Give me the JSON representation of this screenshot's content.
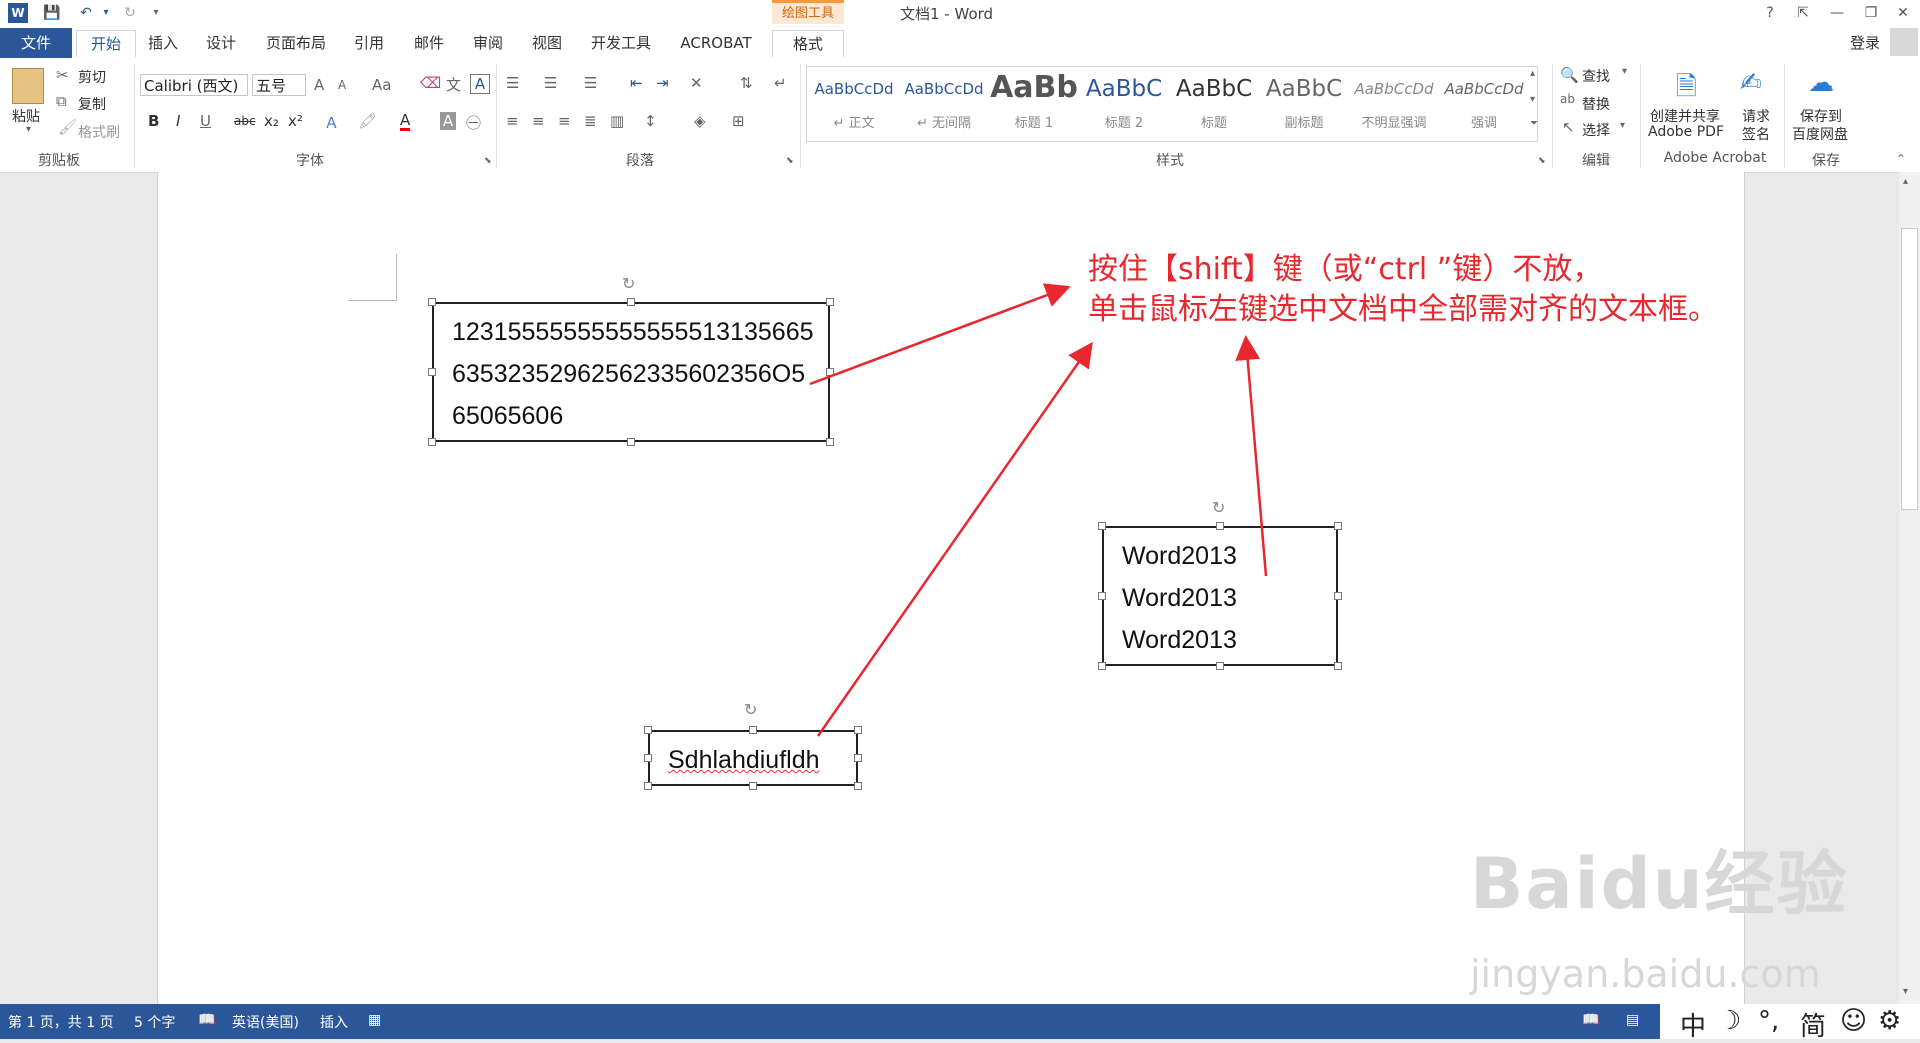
{
  "titlebar": {
    "context_tool": "绘图工具",
    "doc_title": "文档1 - Word",
    "help": "?"
  },
  "tabs": {
    "file": "文件",
    "items": [
      "开始",
      "插入",
      "设计",
      "页面布局",
      "引用",
      "邮件",
      "审阅",
      "视图",
      "开发工具",
      "ACROBAT",
      "格式"
    ],
    "login": "登录"
  },
  "clipboard": {
    "paste": "粘贴",
    "cut": "剪切",
    "copy": "复制",
    "format_painter": "格式刷",
    "label": "剪贴板"
  },
  "font": {
    "name": "Calibri (西文)",
    "size": "五号",
    "label": "字体",
    "bold": "B",
    "italic": "I",
    "underline": "U",
    "strike": "abc",
    "sub": "x₂",
    "sup": "x²",
    "grow": "A",
    "shrink": "A",
    "case": "Aa",
    "color_a": "A"
  },
  "paragraph": {
    "label": "段落"
  },
  "styles": {
    "label": "样式",
    "items": [
      {
        "sample": "AaBbCcDd",
        "name": "↵ 正文"
      },
      {
        "sample": "AaBbCcDd",
        "name": "↵ 无间隔"
      },
      {
        "sample": "AaBb",
        "name": "标题 1"
      },
      {
        "sample": "AaBbC",
        "name": "标题 2"
      },
      {
        "sample": "AaBbC",
        "name": "标题"
      },
      {
        "sample": "AaBbC",
        "name": "副标题"
      },
      {
        "sample": "AaBbCcDd",
        "name": "不明显强调"
      },
      {
        "sample": "AaBbCcDd",
        "name": "强调"
      }
    ]
  },
  "editing": {
    "find": "查找",
    "replace": "替换",
    "select": "选择",
    "label": "编辑"
  },
  "acrobat": {
    "create_share": "创建并共享",
    "adobe_pdf": "Adobe PDF",
    "request": "请求",
    "sign": "签名",
    "label": "Adobe Acrobat"
  },
  "save": {
    "save_to": "保存到",
    "baidu_disk": "百度网盘",
    "label": "保存"
  },
  "document": {
    "box1": [
      "12315555555555555513135665",
      "63532352962562335602356O5",
      "65065606"
    ],
    "box2": [
      "Word2013",
      "Word2013",
      "Word2013"
    ],
    "box3": "Sdhlahdiufldh",
    "annotation_line1": "按住【shift】键（或“ctrl ”键）不放，",
    "annotation_line2": "单击鼠标左键选中文档中全部需对齐的文本框。",
    "watermark": "Baidu经验",
    "watermark_url": "jingyan.baidu.com"
  },
  "status": {
    "page": "第 1 页，共 1 页",
    "words": "5 个字",
    "language": "英语(美国)",
    "mode": "插入"
  },
  "ime": {
    "items": [
      "中",
      "☽",
      "°,",
      "简",
      "☺",
      "⚙"
    ]
  },
  "colors": {
    "brand": "#2b579a",
    "annotation": "#e8282e",
    "context_tab": "#d5670b"
  }
}
